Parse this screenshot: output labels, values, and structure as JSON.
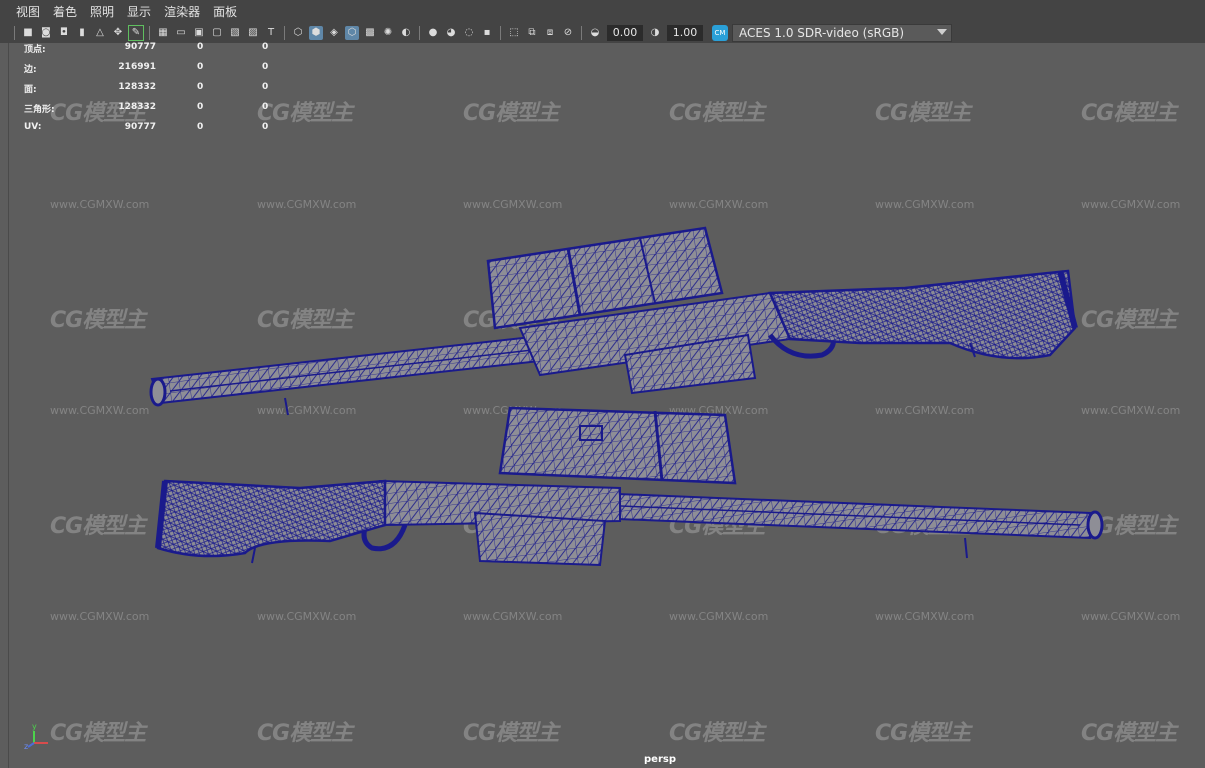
{
  "menu": [
    "视图",
    "着色",
    "照明",
    "显示",
    "渲染器",
    "面板"
  ],
  "toolbar": {
    "exposure_value": "0.00",
    "gamma_value": "1.00",
    "color_space_icon": "color-management-icon",
    "color_space": "ACES 1.0 SDR-video (sRGB)"
  },
  "hud": {
    "rows": [
      {
        "label": "顶点:",
        "v1": "90777",
        "v2": "0",
        "v3": "0"
      },
      {
        "label": "边:",
        "v1": "216991",
        "v2": "0",
        "v3": "0"
      },
      {
        "label": "面:",
        "v1": "128332",
        "v2": "0",
        "v3": "0"
      },
      {
        "label": "三角形:",
        "v1": "128332",
        "v2": "0",
        "v3": "0"
      },
      {
        "label": "UV:",
        "v1": "90777",
        "v2": "0",
        "v3": "0"
      }
    ]
  },
  "viewport": {
    "camera": "persp",
    "watermark_logo": "CG模型主",
    "watermark_url": "www.CGMXW.com",
    "axis_y": "y",
    "axis_z": "z",
    "wire_color": "#1a1a8c",
    "shade_color": "#8a8a90"
  }
}
